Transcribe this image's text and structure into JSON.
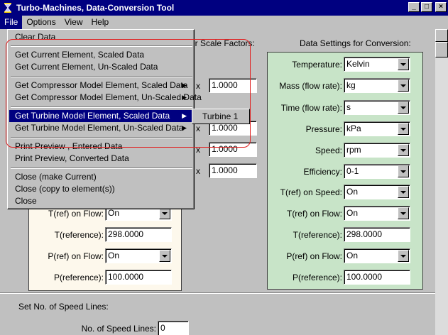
{
  "window": {
    "title": "Turbo-Machines, Data-Conversion Tool",
    "minimize_label": "_",
    "maximize_label": "□",
    "close_label": "×"
  },
  "menubar": {
    "items": [
      {
        "label": "File"
      },
      {
        "label": "Options"
      },
      {
        "label": "View"
      },
      {
        "label": "Help"
      }
    ]
  },
  "file_menu": {
    "items": [
      "Clear Data",
      "Get Current Element, Scaled Data",
      "Get Current Element, Un-Scaled Data",
      "Get Compressor Model Element, Scaled Data",
      "Get Compressor Model Element, Un-Scaled Data",
      "Get Turbine Model Element, Scaled Data",
      "Get Turbine Model Element, Un-Scaled Data",
      "Print Preview , Entered Data",
      "Print Preview, Converted Data",
      "Close (make Current)",
      "Close (copy to element(s))",
      "Close"
    ],
    "submenu_arrow": "▶"
  },
  "submenu": {
    "items": [
      "Turbine 1"
    ]
  },
  "headers": {
    "scale_factors": "er Scale Factors:",
    "conversion": "Data Settings for Conversion:"
  },
  "scale_factors": {
    "multiply": "x",
    "values": [
      "1.0000",
      "1.0000",
      "1.0000",
      "1.0000"
    ]
  },
  "conversion_settings": {
    "temperature": {
      "label": "Temperature:",
      "value": "Kelvin"
    },
    "mass": {
      "label": "Mass (flow rate):",
      "value": "kg"
    },
    "time": {
      "label": "Time (flow rate):",
      "value": "s"
    },
    "pressure": {
      "label": "Pressure:",
      "value": "kPa"
    },
    "speed": {
      "label": "Speed:",
      "value": "rpm"
    },
    "efficiency": {
      "label": "Efficiency:",
      "value": "0-1"
    },
    "tref_speed": {
      "label": "T(ref) on Speed:",
      "value": "On"
    },
    "tref_flow": {
      "label": "T(ref) on Flow:",
      "value": "On"
    },
    "tref": {
      "label": "T(reference):",
      "value": "298.0000"
    },
    "pref_flow": {
      "label": "P(ref) on Flow:",
      "value": "On"
    },
    "pref": {
      "label": "P(reference):",
      "value": "100.0000"
    }
  },
  "entered_settings": {
    "tref_flow": {
      "label": "T(ref) on Flow:",
      "value": "On"
    },
    "tref": {
      "label": "T(reference):",
      "value": "298.0000"
    },
    "pref_flow": {
      "label": "P(ref) on Flow:",
      "value": "On"
    },
    "pref": {
      "label": "P(reference):",
      "value": "100.0000"
    }
  },
  "speed_lines": {
    "header": "Set No. of Speed Lines:",
    "label": "No. of Speed Lines:",
    "value": "0"
  }
}
